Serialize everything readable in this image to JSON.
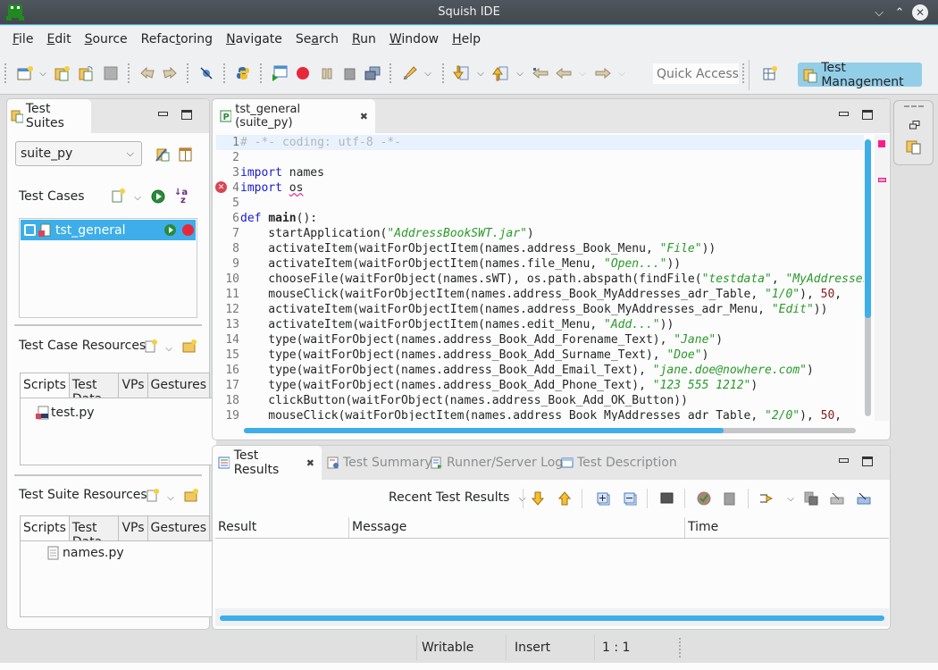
{
  "window": {
    "title": "Squish IDE",
    "controls": [
      "minimize",
      "maximize",
      "close"
    ]
  },
  "menu": [
    {
      "label": "File",
      "mnemonic": "F"
    },
    {
      "label": "Edit",
      "mnemonic": "E"
    },
    {
      "label": "Source",
      "mnemonic": "S"
    },
    {
      "label": "Refactoring",
      "mnemonic": "t"
    },
    {
      "label": "Navigate",
      "mnemonic": "N"
    },
    {
      "label": "Search",
      "mnemonic": "a"
    },
    {
      "label": "Run",
      "mnemonic": "R"
    },
    {
      "label": "Window",
      "mnemonic": "W"
    },
    {
      "label": "Help",
      "mnemonic": "H"
    }
  ],
  "toolbar": {
    "icons": [
      "new-window-icon",
      "new-suite-icon",
      "open-suite-icon",
      "save-icon",
      "undo-icon",
      "redo-icon",
      "pick-icon",
      "python-icon",
      "launch-aut-icon",
      "record-icon",
      "pause-icon",
      "snapshot-icon",
      "compare-icon",
      "highlight-icon",
      "next-annotation-icon",
      "prev-annotation-icon",
      "last-edit-icon",
      "back-icon",
      "forward-icon"
    ],
    "quick_access_placeholder": "Quick Access",
    "perspective_label": "Test Management"
  },
  "left_panel": {
    "tab_label": "Test Suites",
    "suite_selected": "suite_py",
    "test_cases_label": "Test Cases",
    "test_cases": [
      {
        "name": "tst_general",
        "selected": true,
        "checked": false
      }
    ],
    "test_case_resources": {
      "label": "Test Case Resources",
      "tabs": [
        "Scripts",
        "Test Data",
        "VPs",
        "Gestures"
      ],
      "active_tab": "Scripts",
      "files": [
        "test.py"
      ]
    },
    "test_suite_resources": {
      "label": "Test Suite Resources",
      "tabs": [
        "Scripts",
        "Test Data",
        "VPs",
        "Gestures"
      ],
      "active_tab": "Scripts",
      "files": [
        "names.py"
      ]
    }
  },
  "editor": {
    "tab_label": "tst_general (suite_py)",
    "error_line": 4,
    "lines": [
      [
        {
          "t": "cmt",
          "v": "# -*- coding: utf-8 -*-"
        }
      ],
      [],
      [
        {
          "t": "kw",
          "v": "import"
        },
        {
          "t": "",
          "v": " names"
        }
      ],
      [
        {
          "t": "kw",
          "v": "import"
        },
        {
          "t": "",
          "v": " "
        },
        {
          "t": "sq",
          "v": "os"
        }
      ],
      [],
      [
        {
          "t": "kw",
          "v": "def"
        },
        {
          "t": "",
          "v": " "
        },
        {
          "t": "fn",
          "v": "main"
        },
        {
          "t": "",
          "v": "():"
        }
      ],
      [
        {
          "t": "",
          "v": "    startApplication("
        },
        {
          "t": "str",
          "v": "\"AddressBookSWT.jar\""
        },
        {
          "t": "",
          "v": ")"
        }
      ],
      [
        {
          "t": "",
          "v": "    activateItem(waitForObjectItem(names.address_Book_Menu, "
        },
        {
          "t": "str",
          "v": "\"File\""
        },
        {
          "t": "",
          "v": "))"
        }
      ],
      [
        {
          "t": "",
          "v": "    activateItem(waitForObjectItem(names.file_Menu, "
        },
        {
          "t": "str",
          "v": "\"Open...\""
        },
        {
          "t": "",
          "v": "))"
        }
      ],
      [
        {
          "t": "",
          "v": "    chooseFile(waitForObject(names.sWT), os.path.abspath(findFile("
        },
        {
          "t": "str",
          "v": "\"testdata\""
        },
        {
          "t": "",
          "v": ", "
        },
        {
          "t": "str",
          "v": "\"MyAddresses.adr\""
        },
        {
          "t": "",
          "v": ")))"
        }
      ],
      [
        {
          "t": "",
          "v": "    mouseClick(waitForObjectItem(names.address_Book_MyAddresses_adr_Table, "
        },
        {
          "t": "str",
          "v": "\"1/0\""
        },
        {
          "t": "",
          "v": "), "
        },
        {
          "t": "num",
          "v": "50"
        },
        {
          "t": "",
          "v": ", "
        }
      ],
      [
        {
          "t": "",
          "v": "    activateItem(waitForObjectItem(names.address_Book_MyAddresses_adr_Menu, "
        },
        {
          "t": "str",
          "v": "\"Edit\""
        },
        {
          "t": "",
          "v": "))"
        }
      ],
      [
        {
          "t": "",
          "v": "    activateItem(waitForObjectItem(names.edit_Menu, "
        },
        {
          "t": "str",
          "v": "\"Add...\""
        },
        {
          "t": "",
          "v": "))"
        }
      ],
      [
        {
          "t": "",
          "v": "    type(waitForObject(names.address_Book_Add_Forename_Text), "
        },
        {
          "t": "str",
          "v": "\"Jane\""
        },
        {
          "t": "",
          "v": ")"
        }
      ],
      [
        {
          "t": "",
          "v": "    type(waitForObject(names.address_Book_Add_Surname_Text), "
        },
        {
          "t": "str",
          "v": "\"Doe\""
        },
        {
          "t": "",
          "v": ")"
        }
      ],
      [
        {
          "t": "",
          "v": "    type(waitForObject(names.address_Book_Add_Email_Text), "
        },
        {
          "t": "str",
          "v": "\"jane.doe@nowhere.com\""
        },
        {
          "t": "",
          "v": ")"
        }
      ],
      [
        {
          "t": "",
          "v": "    type(waitForObject(names.address_Book_Add_Phone_Text), "
        },
        {
          "t": "str",
          "v": "\"123 555 1212\""
        },
        {
          "t": "",
          "v": ")"
        }
      ],
      [
        {
          "t": "",
          "v": "    clickButton(waitForObject(names.address_Book_Add_OK_Button))"
        }
      ],
      [
        {
          "t": "",
          "v": "    mouseClick(waitForObjectItem(names.address_Book_MyAddresses_adr_Table, "
        },
        {
          "t": "str",
          "v": "\"2/0\""
        },
        {
          "t": "",
          "v": "), "
        },
        {
          "t": "num",
          "v": "50"
        },
        {
          "t": "",
          "v": ", "
        }
      ]
    ]
  },
  "results": {
    "tabs": [
      {
        "label": "Test Results",
        "active": true
      },
      {
        "label": "Test Summary",
        "active": false
      },
      {
        "label": "Runner/Server Log",
        "active": false
      },
      {
        "label": "Test Description",
        "active": false
      }
    ],
    "recent_label": "Recent Test Results",
    "columns": [
      "Result",
      "Message",
      "Time"
    ],
    "rows": []
  },
  "statusbar": {
    "mode": "Writable",
    "insert": "Insert",
    "position": "1 : 1"
  },
  "colors": {
    "accent": "#3daee9",
    "selection": "#3daee9",
    "perspective_active": "#93cee9",
    "error": "#da4453",
    "string": "#2a9a2a",
    "keyword": "#1a1ad6"
  }
}
